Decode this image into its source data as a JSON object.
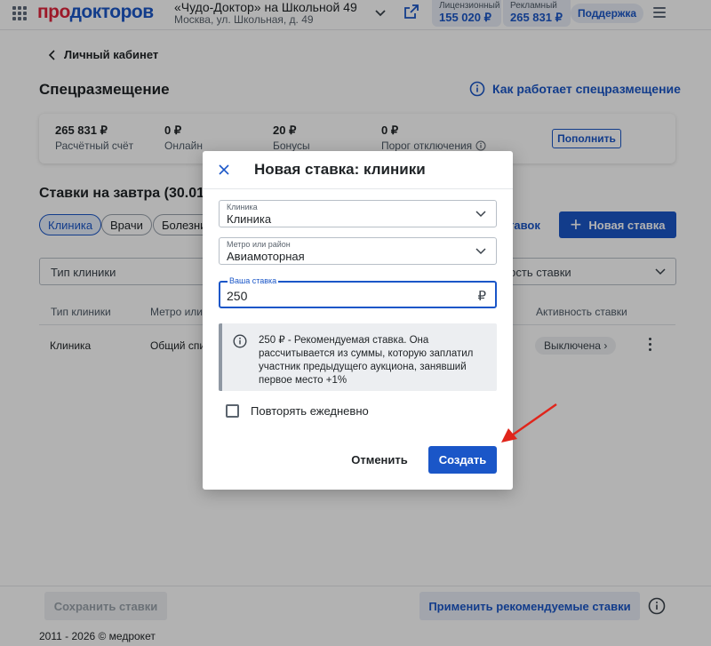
{
  "header": {
    "logo_part1": "про",
    "logo_part2": "докторов",
    "clinic_name": "«Чудо-Доктор» на Школьной 49",
    "clinic_address": "Москва, ул. Школьная, д. 49",
    "license_label": "Лицензионный",
    "license_value": "155 020 ₽",
    "ad_label": "Рекламный",
    "ad_value": "265 831 ₽",
    "support_label": "Поддержка"
  },
  "page": {
    "back_label": "Личный кабинет",
    "title": "Спецразмещение",
    "how_link": "Как работает спецразмещение"
  },
  "stats": [
    {
      "value": "265 831 ₽",
      "label": "Расчётный счёт"
    },
    {
      "value": "0 ₽",
      "label": "Онлайн"
    },
    {
      "value": "20 ₽",
      "label": "Бонусы"
    },
    {
      "value": "0 ₽",
      "label": "Порог отключения"
    }
  ],
  "topup_label": "Пополнить",
  "bids": {
    "section_title": "Ставки на завтра (30.01",
    "chips": [
      "Клиника",
      "Врачи",
      "Болезни"
    ],
    "bids_link": "тавок",
    "new_bid_label": "Новая ставка",
    "filter_clinic_type": "Тип клиники",
    "filter_activity": "ность ставки",
    "columns": [
      "Тип клиники",
      "Метро или",
      "Активность ставки"
    ],
    "row": {
      "type": "Клиника",
      "metro": "Общий спи",
      "status": "Выключена"
    }
  },
  "footer": {
    "save_label": "Сохранить ставки",
    "apply_label": "Применить рекомендуемые ставки",
    "copyright": "2011 - 2026 © медрокет"
  },
  "modal": {
    "title": "Новая ставка: клиники",
    "clinic_label": "Клиника",
    "clinic_value": "Клиника",
    "metro_label": "Метро или район",
    "metro_value": "Авиамоторная",
    "bid_label": "Ваша ставка",
    "bid_value": "250",
    "currency": "₽",
    "hint": "250 ₽ - Рекомендуемая ставка. Она рассчитывается из суммы, которую заплатил участник предыдущего аукциона, занявший первое место +1%",
    "repeat_label": "Повторять ежедневно",
    "cancel_label": "Отменить",
    "create_label": "Создать"
  },
  "colors": {
    "primary": "#1a56c8",
    "logo_red": "#e0253b",
    "annotation_arrow": "#e0251b"
  }
}
